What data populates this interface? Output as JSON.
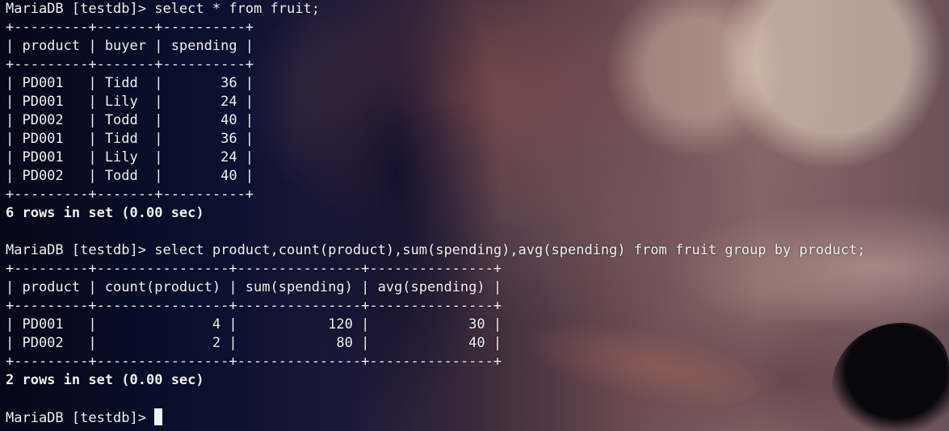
{
  "terminal": {
    "lines": [
      "MariaDB [testdb]> select * from fruit;",
      "+---------+-------+----------+",
      "| product | buyer | spending |",
      "+---------+-------+----------+",
      "| PD001   | Tidd  |       36 |",
      "| PD001   | Lily  |       24 |",
      "| PD002   | Todd  |       40 |",
      "| PD001   | Tidd  |       36 |",
      "| PD001   | Lily  |       24 |",
      "| PD002   | Todd  |       40 |",
      "+---------+-------+----------+",
      "6 rows in set (0.00 sec)",
      "",
      "MariaDB [testdb]> select product,count(product),sum(spending),avg(spending) from fruit group by product;",
      "+---------+----------------+---------------+---------------+",
      "| product | count(product) | sum(spending) | avg(spending) |",
      "+---------+----------------+---------------+---------------+",
      "| PD001   |              4 |           120 |            30 |",
      "| PD002   |              2 |            80 |            40 |",
      "+---------+----------------+---------------+---------------+",
      "2 rows in set (0.00 sec)",
      "",
      "MariaDB [testdb]> "
    ]
  },
  "colors": {
    "text": "#f2f2f2",
    "cursor": "#f2f2f2"
  }
}
